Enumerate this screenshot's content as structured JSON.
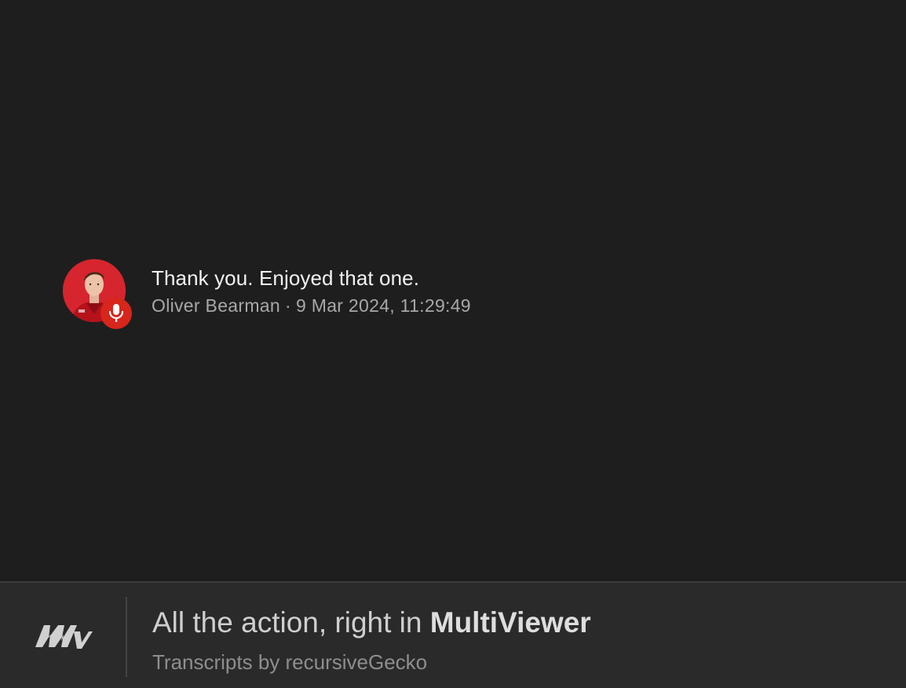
{
  "message": {
    "avatar_icon": "driver-portrait-avatar",
    "badge_icon": "microphone-icon",
    "badge_color": "#d7261c",
    "avatar_color": "#d6252e",
    "text": "Thank you. Enjoyed that one.",
    "author": "Oliver Bearman",
    "separator": "·",
    "timestamp": "9 Mar 2024, 11:29:49"
  },
  "footer": {
    "logo_icon": "multiviewer-logo",
    "tagline_prefix": "All the action, right in ",
    "tagline_brand": "MultiViewer",
    "credit": "Transcripts by recursiveGecko"
  },
  "colors": {
    "background": "#1e1e1e",
    "footer_background": "#2a2a2a",
    "text_primary": "#f2f2f2",
    "text_secondary": "#a8a8a8"
  }
}
